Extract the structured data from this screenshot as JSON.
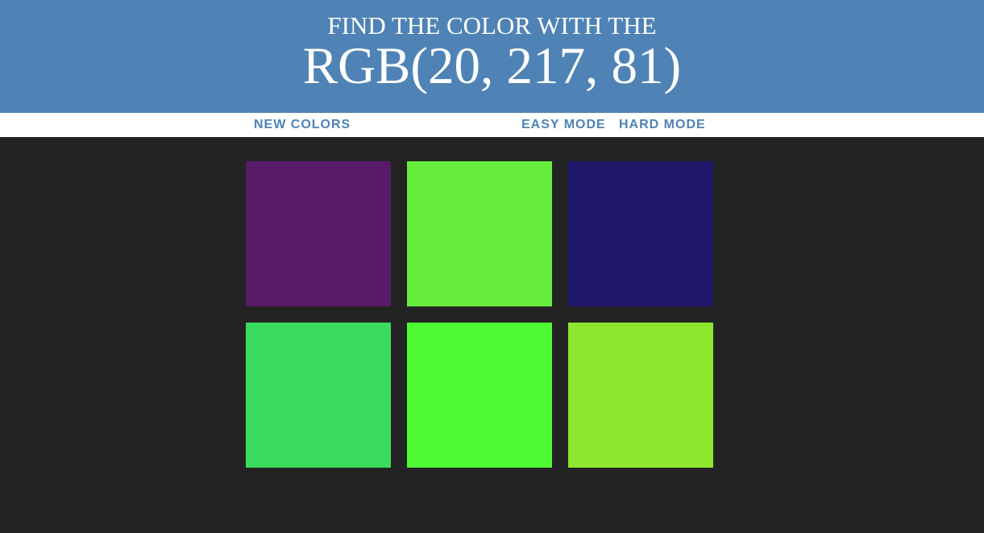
{
  "header": {
    "subtitle": "FIND THE COLOR WITH THE",
    "target_rgb": "RGB(20, 217, 81)",
    "background_color": "#4f83b5"
  },
  "controls": {
    "new_colors_label": "NEW COLORS",
    "easy_mode_label": "EASY MODE",
    "hard_mode_label": "HARD MODE"
  },
  "board": {
    "background_color": "#232323",
    "squares": [
      {
        "color": "#591a68"
      },
      {
        "color": "#67ec3c"
      },
      {
        "color": "#1f186a"
      },
      {
        "color": "#38db5d"
      },
      {
        "color": "#4ff934"
      },
      {
        "color": "#8fe62f"
      }
    ]
  }
}
